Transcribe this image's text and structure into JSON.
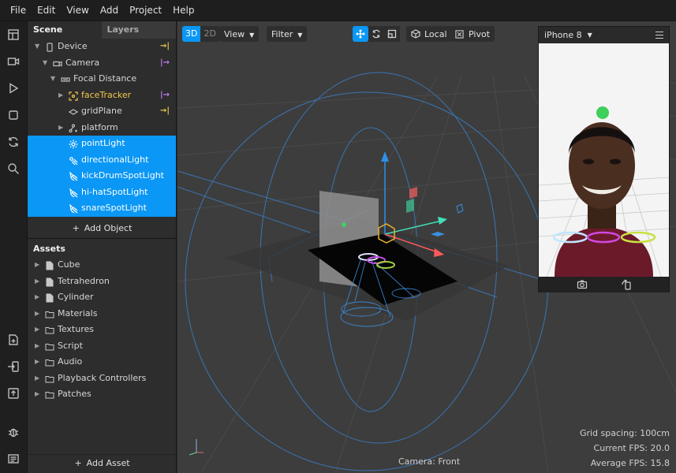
{
  "menubar": [
    "File",
    "Edit",
    "View",
    "Add",
    "Project",
    "Help"
  ],
  "scene": {
    "tab_scene": "Scene",
    "tab_layers": "Layers",
    "tree": [
      {
        "label": "Device",
        "depth": 0,
        "arrow": "▼",
        "icon": "device-icon",
        "tag": "→|",
        "tag_color": "yellow",
        "selected": false
      },
      {
        "label": "Camera",
        "depth": 1,
        "arrow": "▼",
        "icon": "camera-icon",
        "tag": "|→",
        "tag_color": "purple",
        "selected": false
      },
      {
        "label": "Focal Distance",
        "depth": 2,
        "arrow": "▼",
        "icon": "focal-distance-icon",
        "tag": "",
        "selected": false
      },
      {
        "label": "faceTracker",
        "depth": 3,
        "arrow": "▶",
        "icon": "face-tracker-icon",
        "tag": "|→",
        "tag_color": "purple",
        "selected": false,
        "highlight": true
      },
      {
        "label": "gridPlane",
        "depth": 3,
        "arrow": "",
        "icon": "plane-icon",
        "tag": "→|",
        "tag_color": "yellow",
        "selected": false
      },
      {
        "label": "platform",
        "depth": 3,
        "arrow": "▶",
        "icon": "null-object-icon",
        "tag": "",
        "selected": false
      },
      {
        "label": "pointLight",
        "depth": 3,
        "arrow": "",
        "icon": "point-light-icon",
        "tag": "",
        "selected": true
      },
      {
        "label": "directionalLight",
        "depth": 3,
        "arrow": "",
        "icon": "directional-light-icon",
        "tag": "",
        "selected": true
      },
      {
        "label": "kickDrumSpotLight",
        "depth": 3,
        "arrow": "",
        "icon": "spot-light-icon",
        "tag": "",
        "selected": true
      },
      {
        "label": "hi-hatSpotLight",
        "depth": 3,
        "arrow": "",
        "icon": "spot-light-icon",
        "tag": "",
        "selected": true
      },
      {
        "label": "snareSpotLight",
        "depth": 3,
        "arrow": "",
        "icon": "spot-light-icon",
        "tag": "",
        "selected": true
      }
    ],
    "add_object": "Add Object"
  },
  "assets": {
    "title": "Assets",
    "items": [
      {
        "label": "Cube",
        "icon": "file-icon"
      },
      {
        "label": "Tetrahedron",
        "icon": "file-icon"
      },
      {
        "label": "Cylinder",
        "icon": "file-icon"
      },
      {
        "label": "Materials",
        "icon": "folder-icon"
      },
      {
        "label": "Textures",
        "icon": "folder-icon"
      },
      {
        "label": "Script",
        "icon": "folder-icon"
      },
      {
        "label": "Audio",
        "icon": "folder-icon"
      },
      {
        "label": "Playback Controllers",
        "icon": "folder-icon"
      },
      {
        "label": "Patches",
        "icon": "folder-icon"
      }
    ],
    "add_asset": "Add Asset"
  },
  "toolbar": {
    "mode_3d": "3D",
    "mode_2d": "2D",
    "view": "View",
    "filter": "Filter",
    "local": "Local",
    "pivot": "Pivot"
  },
  "preview": {
    "device": "iPhone 8"
  },
  "viewport": {
    "camera_label": "Camera: Front",
    "grid_spacing": "Grid spacing: 100cm",
    "current_fps": "Current FPS:  20.0",
    "average_fps": "Average FPS:  15.8"
  },
  "colors": {
    "accent": "#0a97f5",
    "highlight_yellow": "#f0c84a",
    "tag_purple": "#c07bf0",
    "gizmo_blue": "#2f8fe8",
    "gizmo_green": "#3fe0b8",
    "gizmo_red": "#ff5a5a"
  }
}
